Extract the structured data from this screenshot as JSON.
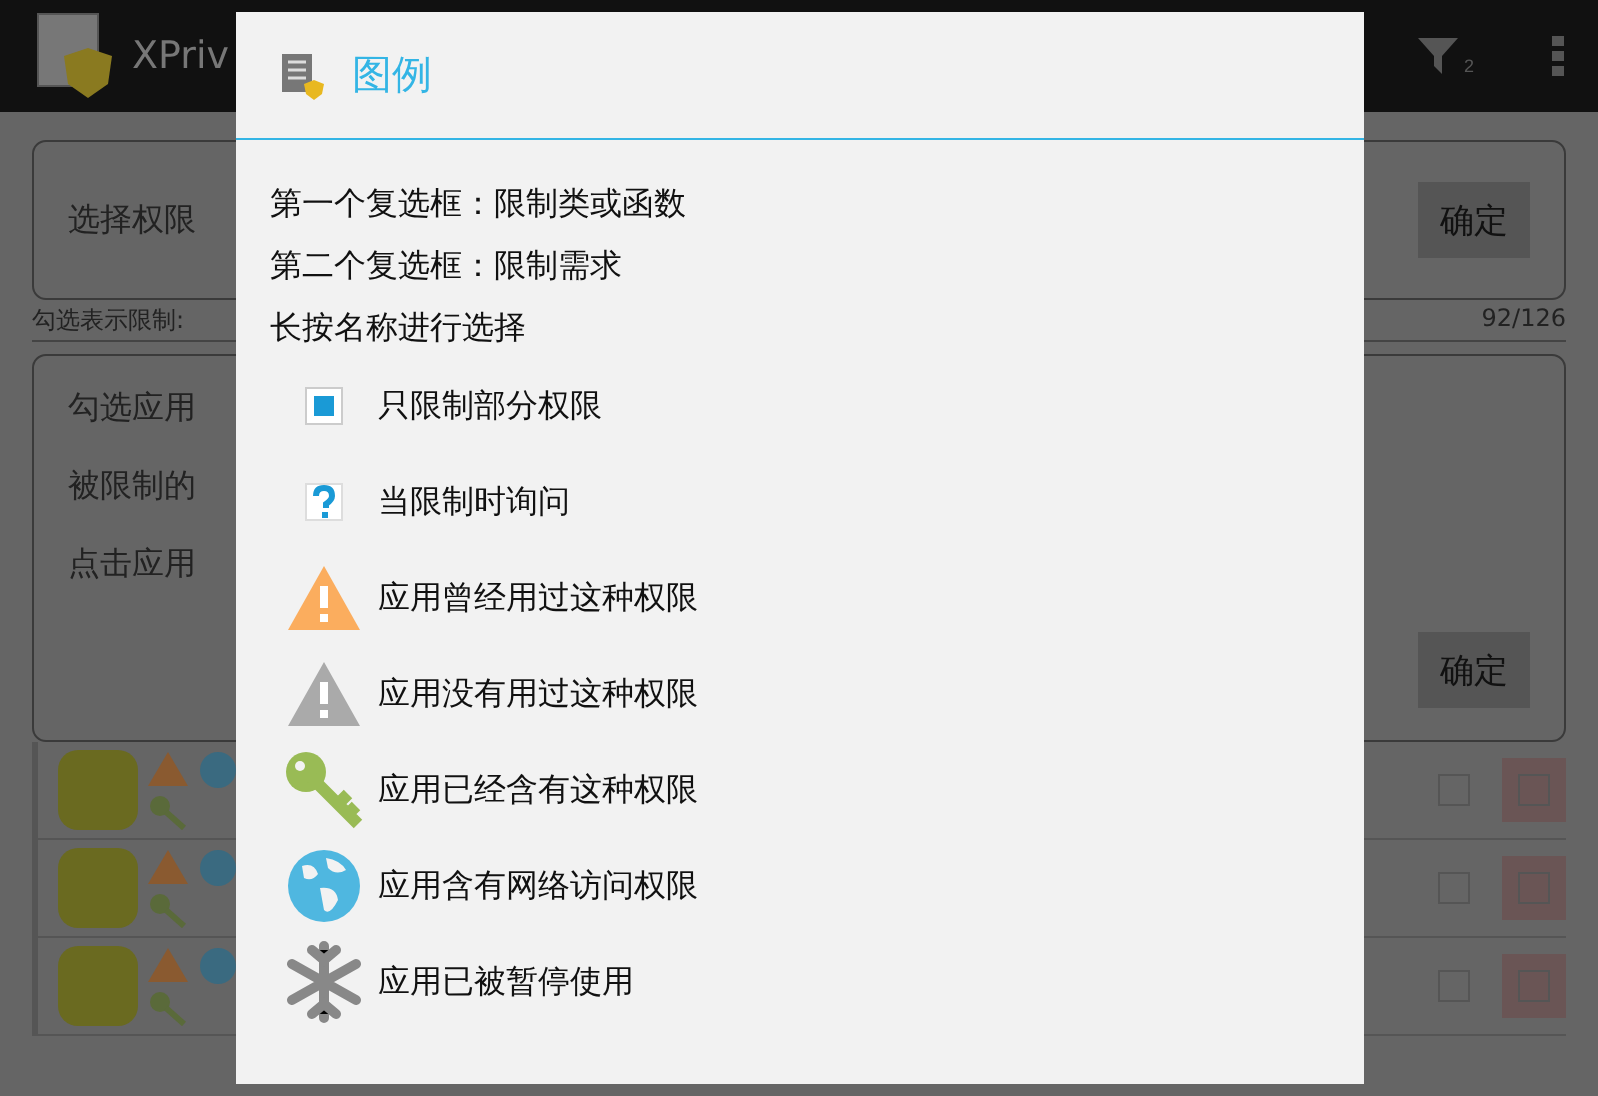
{
  "action_bar": {
    "title": "XPriv",
    "filter_count": "2"
  },
  "category_card": {
    "text": "选择权限",
    "button": "确定"
  },
  "hint_row": {
    "label": "勾选表示限制:",
    "count": "92/126"
  },
  "info_card": {
    "lines": [
      "勾选应用",
      "被限制的",
      "点击应用"
    ],
    "button": "确定"
  },
  "apps": [
    {
      "restricted": false,
      "partial": false
    },
    {
      "restricted": false,
      "partial": false
    },
    {
      "restricted": false,
      "partial": false
    }
  ],
  "dialog": {
    "title": "图例",
    "notes": [
      "第一个复选框：限制类或函数",
      "第二个复选框：限制需求",
      "长按名称进行选择"
    ],
    "legend": [
      {
        "kind": "partial",
        "label": "只限制部分权限"
      },
      {
        "kind": "ask",
        "label": "当限制时询问"
      },
      {
        "kind": "used",
        "label": "应用曾经用过这种权限"
      },
      {
        "kind": "unused",
        "label": "应用没有用过这种权限"
      },
      {
        "kind": "granted",
        "label": "应用已经含有这种权限"
      },
      {
        "kind": "internet",
        "label": "应用含有网络访问权限"
      },
      {
        "kind": "frozen",
        "label": "应用已被暂停使用"
      }
    ]
  }
}
